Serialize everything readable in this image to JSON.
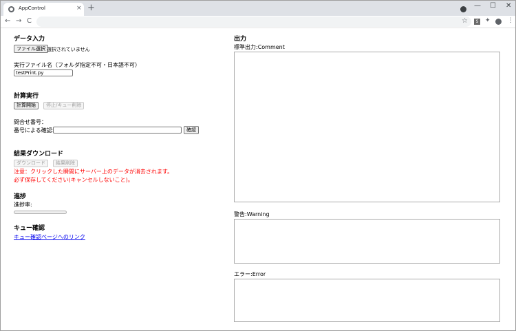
{
  "browser": {
    "tab_title": "AppControl",
    "close_glyph": "×",
    "newtab_glyph": "+",
    "ext_label": "S",
    "back_glyph": "←",
    "forward_glyph": "→",
    "reload_glyph": "C",
    "star_glyph": "☆",
    "puzzle_glyph": "✦",
    "menu_glyph": "⋮",
    "minimize_glyph": "—",
    "maximize_glyph": "☐",
    "window_close_glyph": "✕"
  },
  "left": {
    "data_input": {
      "heading": "データ入力",
      "file_button": "ファイル選択",
      "file_status": "選択されていません"
    },
    "exec_file": {
      "label": "実行ファイル名（フォルダ指定不可・日本語不可）",
      "value": "testPrint.py"
    },
    "calc": {
      "heading": "計算実行",
      "start_button": "計算開始",
      "stop_button": "停止/キュー削除"
    },
    "inquiry": {
      "label": "問合せ番号：",
      "confirm_label": "番号による確認:",
      "confirm_button": "確認"
    },
    "download": {
      "heading": "結果ダウンロード",
      "download_button": "ダウンロード",
      "delete_button": "結果削除",
      "warning_1": "注意：クリックした瞬間にサーバー上のデータが消去されます。",
      "warning_2": "必ず保存してください(キャンセルしないこと)。"
    },
    "progress": {
      "heading": "進捗",
      "label": "進捗率:",
      "value": 0
    },
    "queue": {
      "heading": "キュー確認",
      "link": "キュー確認ページへのリンク"
    }
  },
  "right": {
    "heading": "出力",
    "stdout_label": "標準出力:Comment",
    "warning_label": "警告:Warning",
    "error_label": "エラー:Error"
  },
  "colors": {
    "warning_text": "#ff0000",
    "link": "#0000ee"
  }
}
